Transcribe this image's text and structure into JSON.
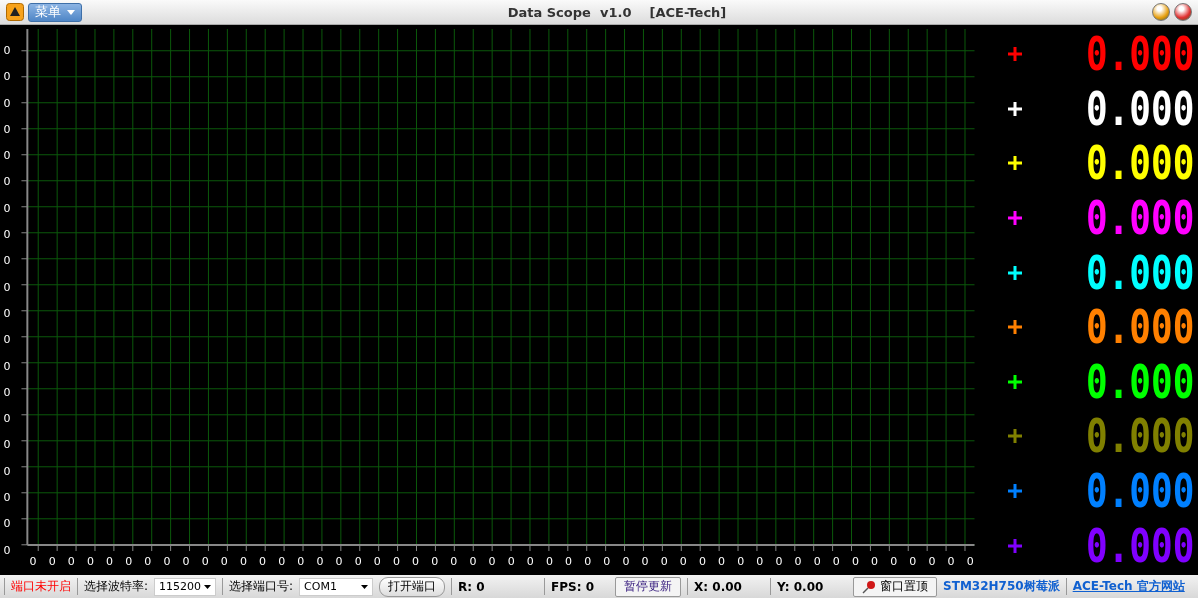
{
  "window": {
    "title": "Data Scope  v1.0    [ACE-Tech]"
  },
  "menu_button": {
    "label": "菜单"
  },
  "plot": {
    "y_labels": [
      "0",
      "0",
      "0",
      "0",
      "0",
      "0",
      "0",
      "0",
      "0",
      "0",
      "0",
      "0",
      "0",
      "0",
      "0",
      "0",
      "0",
      "0",
      "0",
      "0"
    ],
    "x_labels": [
      "0",
      "0",
      "0",
      "0",
      "0",
      "0",
      "0",
      "0",
      "0",
      "0",
      "0",
      "0",
      "0",
      "0",
      "0",
      "0",
      "0",
      "0",
      "0",
      "0",
      "0",
      "0",
      "0",
      "0",
      "0",
      "0",
      "0",
      "0",
      "0",
      "0",
      "0",
      "0",
      "0",
      "0",
      "0",
      "0",
      "0",
      "0",
      "0",
      "0",
      "0",
      "0",
      "0",
      "0",
      "0",
      "0",
      "0",
      "0",
      "0",
      "0"
    ]
  },
  "channels": [
    {
      "color": "#ff0000",
      "display": "0.000"
    },
    {
      "color": "#ffffff",
      "display": "0.000"
    },
    {
      "color": "#ffff00",
      "display": "0.000"
    },
    {
      "color": "#ff00ff",
      "display": "0.000"
    },
    {
      "color": "#00ffff",
      "display": "0.000"
    },
    {
      "color": "#ff8000",
      "display": "0.000"
    },
    {
      "color": "#00ff00",
      "display": "0.000"
    },
    {
      "color": "#808000",
      "display": "0.000"
    },
    {
      "color": "#0080ff",
      "display": "0.000"
    },
    {
      "color": "#8000ff",
      "display": "0.000"
    }
  ],
  "status_bar": {
    "port_status": "端口未开启",
    "baud_label": "选择波特率:",
    "baud_value": "115200",
    "port_label": "选择端口号:",
    "port_value": "COM1",
    "open_button": "打开端口",
    "r_reading": "R: 0",
    "fps_reading": "FPS: 0",
    "pause_button": "暂停更新",
    "x_reading": "X: 0.00",
    "y_reading": "Y: 0.00",
    "pin_button": "窗口置顶",
    "board_label": "STM32H750树莓派",
    "website_link": "ACE-Tech 官方网站"
  }
}
